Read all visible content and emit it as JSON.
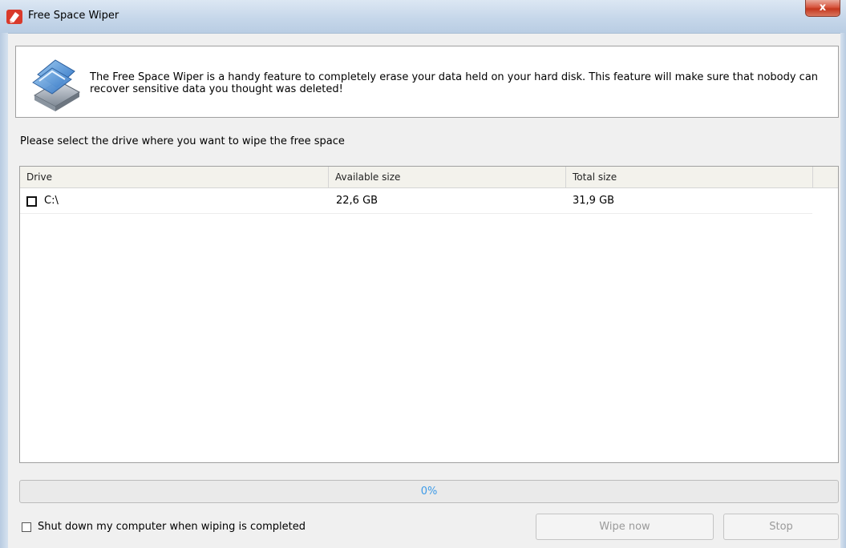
{
  "window": {
    "title": "Free Space Wiper",
    "close_glyph": "x",
    "icon": "free-space-wiper-app-icon"
  },
  "info": {
    "text": "The Free Space Wiper is a handy feature to completely erase your data held on your hard disk. This feature will make sure that nobody can recover sensitive data you thought was deleted!",
    "icon": "hard-drive-icon"
  },
  "prompt": "Please select the drive where you want to wipe the free space",
  "table": {
    "columns": [
      "Drive",
      "Available size",
      "Total size"
    ],
    "rows": [
      {
        "checked": false,
        "drive": "C:\\",
        "available": "22,6 GB",
        "total": "31,9 GB"
      }
    ]
  },
  "progress": {
    "value": 0,
    "label": "0%"
  },
  "options": {
    "shutdown_label": "Shut down my computer when wiping is completed",
    "shutdown_checked": false
  },
  "buttons": {
    "wipe": "Wipe now",
    "stop": "Stop"
  },
  "colors": {
    "accent": "#3d9be8",
    "close": "#c4371e",
    "disabled_text": "#9a9a9a"
  }
}
